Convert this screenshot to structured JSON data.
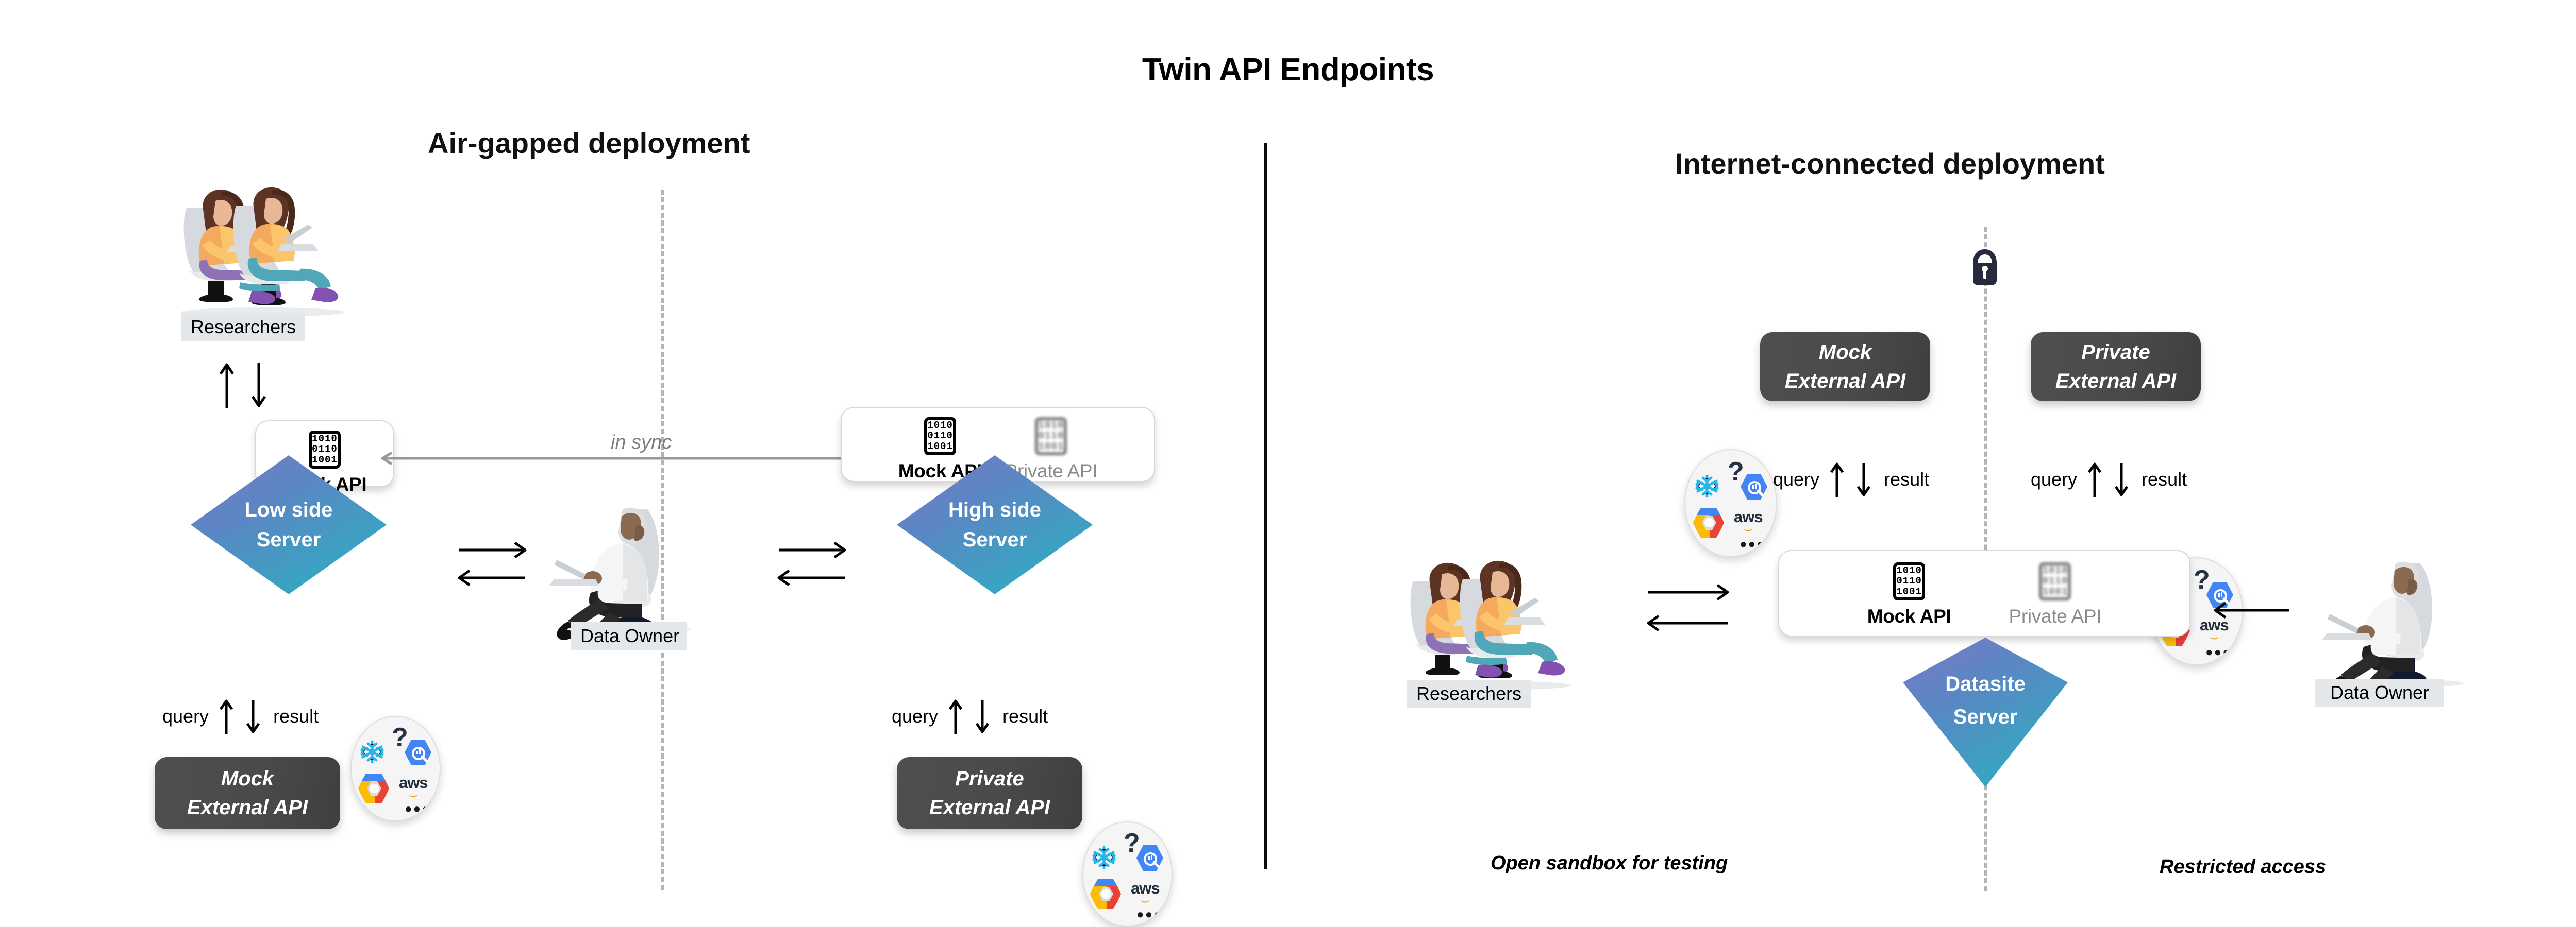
{
  "page": {
    "title": "Twin API Endpoints",
    "background": "#ffffff"
  },
  "colors": {
    "server_gradient_start": "#7a79c4",
    "server_gradient_end": "#20b3c4",
    "external_api_pill": "#4a4a4a",
    "private_api_label": "#8b8b8b",
    "divider": "#0d0d0d",
    "dashed_divider": "#b4b4b4",
    "in_sync_text": "#7c7c7c",
    "person_label_bg": "#e4e7ea",
    "aws_orange": "#ff9900",
    "snowflake_blue": "#29b5e8",
    "bigquery_blue": "#4285f4"
  },
  "sections": {
    "left": {
      "title": "Air-gapped deployment"
    },
    "right": {
      "title": "Internet-connected deployment"
    }
  },
  "left_panel": {
    "researchers_label": "Researchers",
    "data_owner_label": "Data Owner",
    "in_sync_label": "in sync",
    "low_server": {
      "line1": "Low side",
      "line2": "Server"
    },
    "high_server": {
      "line1": "High side",
      "line2": "Server"
    },
    "mock_api_label": "Mock API",
    "high_mock_api_label": "Mock API",
    "private_api_label": "Private API",
    "binary_icon_rows": [
      "1010",
      "0110",
      "1001"
    ],
    "query_label": "query",
    "result_label": "result",
    "mock_external_api": {
      "line1": "Mock",
      "line2": "External API"
    },
    "private_external_api": {
      "line1": "Private",
      "line2": "External API"
    }
  },
  "right_panel": {
    "researchers_label": "Researchers",
    "data_owner_label": "Data Owner",
    "mock_external_api": {
      "line1": "Mock",
      "line2": "External API"
    },
    "private_external_api": {
      "line1": "Private",
      "line2": "External API"
    },
    "query_label_left": "query",
    "result_label_left": "result",
    "query_label_right": "query",
    "result_label_right": "result",
    "mock_api_label": "Mock API",
    "private_api_label": "Private API",
    "binary_icon_rows": [
      "1010",
      "0110",
      "1001"
    ],
    "datasite_server": {
      "line1": "Datasite",
      "line2": "Server"
    },
    "caption_left": "Open sandbox for testing",
    "caption_right": "Restricted access",
    "lock_icon": "lock-icon"
  },
  "cloud_logos": {
    "question_mark": "?",
    "ellipsis": "•••",
    "aws_text": "aws",
    "snowflake": "snowflake-logo",
    "bigquery": "bigquery-logo",
    "google_cloud": "google-cloud-logo"
  },
  "icons": {
    "arrow_up": "arrow-up-icon",
    "arrow_down": "arrow-down-icon",
    "arrow_left": "arrow-left-icon",
    "arrow_right": "arrow-right-icon",
    "mock_api": "binary-code-icon",
    "private_api": "blurred-binary-code-icon"
  }
}
